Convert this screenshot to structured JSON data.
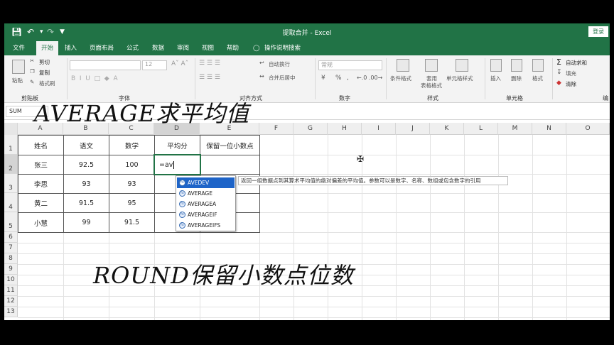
{
  "window": {
    "title": "提取合并 - Excel",
    "login_label": "登录"
  },
  "quick_access": {
    "save_icon": "save-icon",
    "undo_icon": "undo-icon",
    "redo_icon": "redo-icon",
    "customize_icon": "customize-icon"
  },
  "tabs": [
    {
      "label": "文件"
    },
    {
      "label": "开始",
      "active": true
    },
    {
      "label": "插入"
    },
    {
      "label": "页面布局"
    },
    {
      "label": "公式"
    },
    {
      "label": "数据"
    },
    {
      "label": "审阅"
    },
    {
      "label": "视图"
    },
    {
      "label": "帮助"
    },
    {
      "label": "操作说明搜索"
    }
  ],
  "ribbon": {
    "clipboard": {
      "paste": "粘贴",
      "cut": "剪切",
      "copy": "复制",
      "painter": "格式刷",
      "group": "剪贴板"
    },
    "font": {
      "size": "12",
      "group": "字体"
    },
    "alignment": {
      "wrap": "自动换行",
      "merge": "合并后居中",
      "group": "对齐方式"
    },
    "number": {
      "format": "常规",
      "percent": "%",
      "comma": ",",
      "group": "数字"
    },
    "styles": {
      "conditional": "条件格式",
      "table_1": "套用",
      "table_2": "表格格式",
      "cell_styles": "单元格样式",
      "group": "样式"
    },
    "cells": {
      "insert": "插入",
      "delete": "删除",
      "format": "格式",
      "group": "单元格"
    },
    "editing": {
      "autosum": "自动求和",
      "fill": "填充",
      "clear": "清除",
      "group": "编"
    }
  },
  "formula_bar": {
    "name_box": "SUM"
  },
  "columns": [
    "A",
    "B",
    "C",
    "D",
    "E",
    "F",
    "G",
    "H",
    "I",
    "J",
    "K",
    "L",
    "M",
    "N",
    "O"
  ],
  "rows": [
    "1",
    "2",
    "3",
    "4",
    "5",
    "6",
    "7",
    "8",
    "9",
    "10",
    "11",
    "12",
    "13"
  ],
  "table": {
    "headers": [
      "姓名",
      "语文",
      "数学",
      "平均分",
      "保留一位小数点"
    ],
    "rows": [
      [
        "张三",
        "92.5",
        "100"
      ],
      [
        "李思",
        "93",
        "93"
      ],
      [
        "黄二",
        "91.5",
        "95"
      ],
      [
        "小慧",
        "99",
        "91.5"
      ]
    ]
  },
  "active_cell": {
    "value": "=av"
  },
  "autocomplete": {
    "items": [
      "AVEDEV",
      "AVERAGE",
      "AVERAGEA",
      "AVERAGEIF",
      "AVERAGEIFS"
    ],
    "tooltip": "返回一组数据点到其算术平均值的绝对偏差的平均值。参数可以是数字、名称、数组或包含数字的引用"
  },
  "overlays": {
    "top": "AVERAGE求平均值",
    "bottom": "ROUND保留小数点位数"
  },
  "colors": {
    "accent": "#217346",
    "selection": "#1e64c8"
  }
}
